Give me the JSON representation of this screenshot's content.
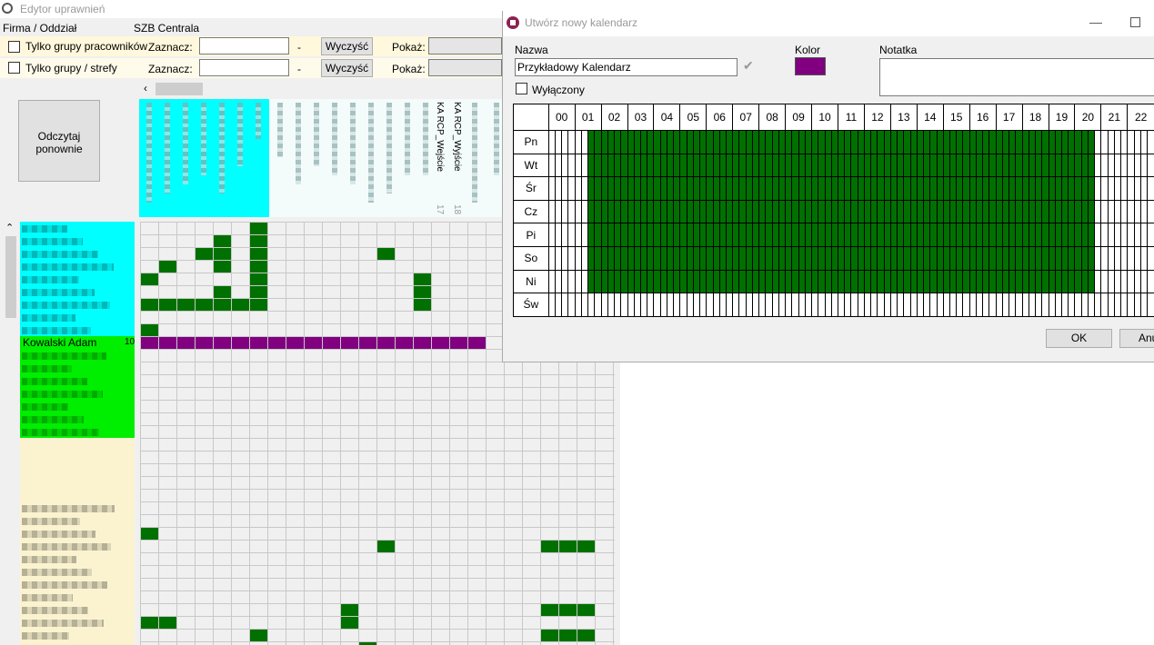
{
  "background_window": {
    "title": "Edytor uprawnień",
    "company_label": "Firma / Oddział",
    "company_value": "SZB Centrala",
    "filters": [
      {
        "checkbox_label": "Tylko grupy pracowników",
        "select_label": "Zaznacz:",
        "dash": "-",
        "clear_label": "Wyczyść",
        "show_label": "Pokaż:"
      },
      {
        "checkbox_label": "Tylko grupy / strefy",
        "select_label": "Zaznacz:",
        "dash": "-",
        "clear_label": "Wyczyść",
        "show_label": "Pokaż:"
      }
    ],
    "reload_button": "Odczytaj ponownie",
    "column_headers": [
      {
        "label": "KA RCP_Wejście",
        "index": "17"
      },
      {
        "label": "KA RCP_Wyjście",
        "index": "18"
      }
    ],
    "highlighted_person": {
      "name": "Kowalski Adam",
      "number": "10"
    },
    "colors": {
      "group_cyan": "#00ffff",
      "group_green": "#00ee00",
      "cell_green": "#007000",
      "calendar_purple": "#800080",
      "yellow_row": "#fff8dc"
    }
  },
  "dialog": {
    "title": "Utwórz nowy kalendarz",
    "name_label": "Nazwa",
    "name_value": "Przykładowy Kalendarz",
    "color_label": "Kolor",
    "color_value": "#800080",
    "note_label": "Notatka",
    "note_value": "",
    "disabled_label": "Wyłączony",
    "disabled_checked": false,
    "ok_label": "OK",
    "cancel_label": "Anu",
    "hours": [
      "00",
      "01",
      "02",
      "03",
      "04",
      "05",
      "06",
      "07",
      "08",
      "09",
      "10",
      "11",
      "12",
      "13",
      "14",
      "15",
      "16",
      "17",
      "18",
      "19",
      "20",
      "21",
      "22"
    ],
    "days": [
      {
        "label": "Pn",
        "active_from_hour": 1.5,
        "active_to_hour": 20.75
      },
      {
        "label": "Wt",
        "active_from_hour": 1.5,
        "active_to_hour": 20.75
      },
      {
        "label": "Śr",
        "active_from_hour": 1.5,
        "active_to_hour": 20.75
      },
      {
        "label": "Cz",
        "active_from_hour": 1.5,
        "active_to_hour": 20.75
      },
      {
        "label": "Pi",
        "active_from_hour": 1.5,
        "active_to_hour": 20.75
      },
      {
        "label": "So",
        "active_from_hour": 1.5,
        "active_to_hour": 20.75
      },
      {
        "label": "Ni",
        "active_from_hour": 1.5,
        "active_to_hour": 20.75
      },
      {
        "label": "Św",
        "active_from_hour": null,
        "active_to_hour": null
      }
    ]
  }
}
